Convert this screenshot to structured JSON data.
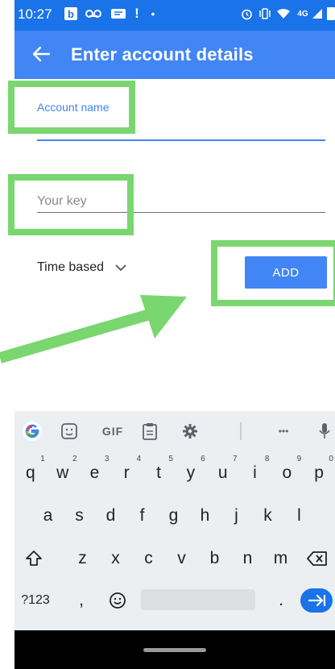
{
  "status_bar": {
    "time": "10:27",
    "network": "4G"
  },
  "app_bar": {
    "title": "Enter account details"
  },
  "form": {
    "account_name_label": "Account name",
    "key_placeholder": "Your key",
    "key_value": "",
    "key_type_selected": "Time based",
    "add_label": "ADD"
  },
  "keyboard": {
    "toolbar": {
      "gif_label": "GIF",
      "more_label": "•••"
    },
    "row1": [
      {
        "k": "q",
        "h": "1"
      },
      {
        "k": "w",
        "h": "2"
      },
      {
        "k": "e",
        "h": "3"
      },
      {
        "k": "r",
        "h": "4"
      },
      {
        "k": "t",
        "h": "5"
      },
      {
        "k": "y",
        "h": "6"
      },
      {
        "k": "u",
        "h": "7"
      },
      {
        "k": "i",
        "h": "8"
      },
      {
        "k": "o",
        "h": "9"
      },
      {
        "k": "p",
        "h": "0"
      }
    ],
    "row2": [
      "a",
      "s",
      "d",
      "f",
      "g",
      "h",
      "j",
      "k",
      "l"
    ],
    "row3": [
      "z",
      "x",
      "c",
      "v",
      "b",
      "n",
      "m"
    ],
    "row4": {
      "symbols_label": "?123",
      "comma": ",",
      "period": "."
    }
  },
  "colors": {
    "status_bar": "#1a73e8",
    "app_bar": "#4285f4",
    "accent": "#4285f4",
    "annotation": "#7ad66f",
    "keyboard_bg": "#eceff1"
  }
}
